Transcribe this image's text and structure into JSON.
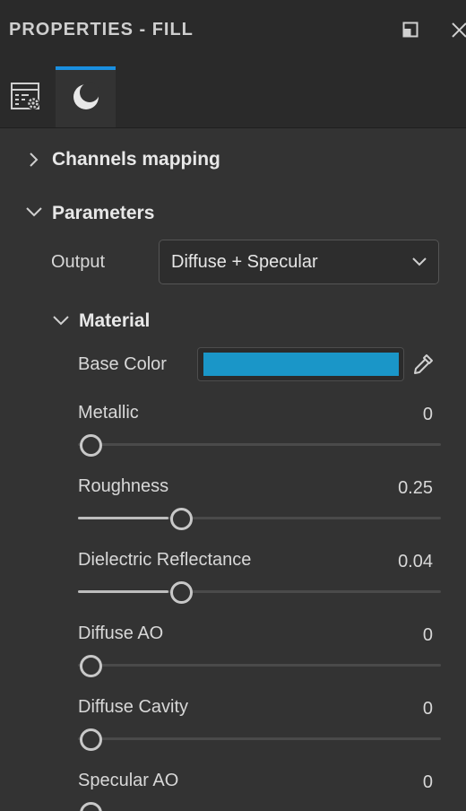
{
  "header": {
    "title": "PROPERTIES - FILL"
  },
  "tabs": [
    {
      "icon": "properties-settings-icon",
      "active": false
    },
    {
      "icon": "material-sphere-icon",
      "active": true
    }
  ],
  "sections": {
    "channels_mapping": "Channels mapping",
    "parameters": "Parameters",
    "material": "Material"
  },
  "output": {
    "label": "Output",
    "value": "Diffuse + Specular"
  },
  "base_color": {
    "label": "Base Color",
    "color": "#1a96c8"
  },
  "sliders": [
    {
      "label": "Metallic",
      "value": "0",
      "fraction": 0.0
    },
    {
      "label": "Roughness",
      "value": "0.25",
      "fraction": 0.25
    },
    {
      "label": "Dielectric Reflectance",
      "value": "0.04",
      "fraction": 0.25
    },
    {
      "label": "Diffuse AO",
      "value": "0",
      "fraction": 0.0
    },
    {
      "label": "Diffuse Cavity",
      "value": "0",
      "fraction": 0.0
    },
    {
      "label": "Specular AO",
      "value": "0",
      "fraction": 0.0
    }
  ],
  "colors": {
    "accent": "#1a8fe0",
    "panel_bg": "#333333",
    "header_bg": "#2a2a2a"
  }
}
